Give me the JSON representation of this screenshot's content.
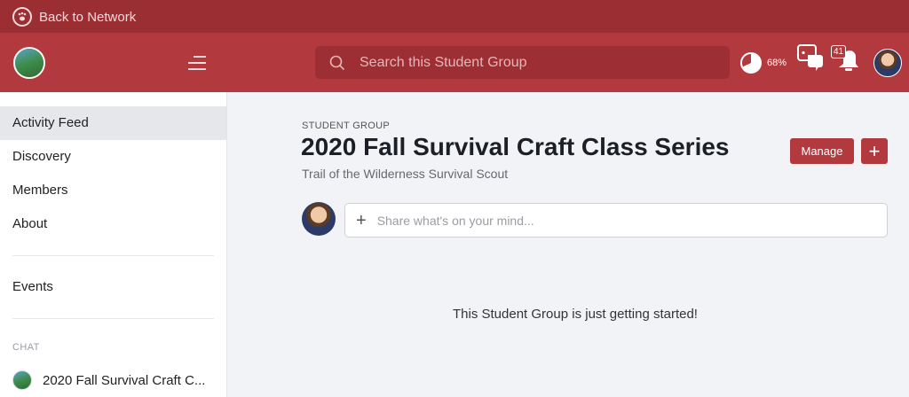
{
  "network_bar": {
    "back_label": "Back to Network"
  },
  "header": {
    "search_placeholder": "Search this Student Group",
    "progress_label": "68%",
    "progress_value": 0.68,
    "chat_badge": "",
    "notifications_badge": "41"
  },
  "sidebar": {
    "nav": [
      {
        "label": "Activity Feed"
      },
      {
        "label": "Discovery"
      },
      {
        "label": "Members"
      },
      {
        "label": "About"
      }
    ],
    "events_label": "Events",
    "chat_section_label": "CHAT",
    "chat_items": [
      {
        "label": "2020 Fall Survival Craft C..."
      }
    ]
  },
  "main": {
    "eyebrow": "STUDENT GROUP",
    "title": "2020 Fall Survival Craft Class Series",
    "subtitle": "Trail of the Wilderness Survival Scout",
    "manage_label": "Manage",
    "add_label": "+",
    "post_placeholder": "Share what's on your mind...",
    "empty_message": "This Student Group is just getting started!"
  },
  "colors": {
    "brand": "#b23a3f",
    "brand_dark": "#9b2e33"
  }
}
